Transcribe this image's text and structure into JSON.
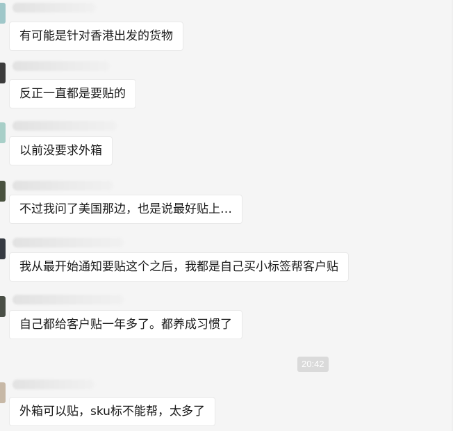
{
  "conversation": {
    "messages": [
      {
        "text": "有可能是针对香港出发的货物",
        "avatar_color": "#9fc7c9"
      },
      {
        "text": "反正一直都是要贴的",
        "avatar_color": "#3c3c3c"
      },
      {
        "text": "以前没要求外箱",
        "avatar_color": "#a8cfc8"
      },
      {
        "text": "不过我问了美国那边，也是说最好贴上…",
        "avatar_color": "#49523f"
      },
      {
        "text": "我从最开始通知要贴这个之后，我都是自己买小标签帮客户贴",
        "avatar_color": "#363a42"
      },
      {
        "text": "自己都给客户贴一年多了。都养成习惯了",
        "avatar_color": "#4a4f46"
      },
      {
        "text": "外箱可以贴，sku标不能帮，太多了",
        "avatar_color": "#c7b8a6"
      }
    ],
    "timestamp": "20:42"
  }
}
